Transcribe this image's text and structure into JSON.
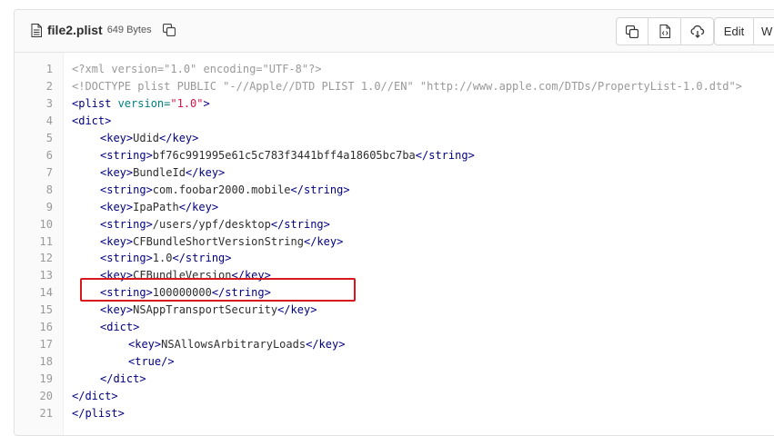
{
  "header": {
    "file_name": "file2.plist",
    "file_size": "649 Bytes",
    "edit_label": "Edit",
    "web_ide_label": "W"
  },
  "icons": {
    "file": "file-icon",
    "copy_path": "copy-icon",
    "copy_contents": "copy-icon",
    "open_raw": "file-code-icon",
    "download": "cloud-download-icon"
  },
  "colors": {
    "tag": "#000080",
    "attribute": "#008080",
    "string": "#dd1144",
    "meta": "#999999",
    "highlight_border": "#d9181e"
  },
  "code_lines": [
    {
      "n": "1",
      "indent": 0,
      "tokens": [
        {
          "t": "meta",
          "v": "<?xml version=\"1.0\" encoding=\"UTF-8\"?>"
        }
      ]
    },
    {
      "n": "2",
      "indent": 0,
      "tokens": [
        {
          "t": "meta",
          "v": "<!DOCTYPE plist PUBLIC \"-//Apple//DTD PLIST 1.0//EN\" \"http://www.apple.com/DTDs/PropertyList-1.0.dtd\">"
        }
      ]
    },
    {
      "n": "3",
      "indent": 0,
      "tokens": [
        {
          "t": "tag",
          "v": "<plist "
        },
        {
          "t": "attr",
          "v": "version="
        },
        {
          "t": "str",
          "v": "\"1.0\""
        },
        {
          "t": "tag",
          "v": ">"
        }
      ]
    },
    {
      "n": "4",
      "indent": 0,
      "tokens": [
        {
          "t": "tag",
          "v": "<dict>"
        }
      ]
    },
    {
      "n": "5",
      "indent": 1,
      "tokens": [
        {
          "t": "tag",
          "v": "<key>"
        },
        {
          "t": "text",
          "v": "Udid"
        },
        {
          "t": "tag",
          "v": "</key>"
        }
      ]
    },
    {
      "n": "6",
      "indent": 1,
      "tokens": [
        {
          "t": "tag",
          "v": "<string>"
        },
        {
          "t": "text",
          "v": "bf76c991995e61c5c783f3441bff4a18605bc7ba"
        },
        {
          "t": "tag",
          "v": "</string>"
        }
      ]
    },
    {
      "n": "7",
      "indent": 1,
      "tokens": [
        {
          "t": "tag",
          "v": "<key>"
        },
        {
          "t": "text",
          "v": "BundleId"
        },
        {
          "t": "tag",
          "v": "</key>"
        }
      ]
    },
    {
      "n": "8",
      "indent": 1,
      "tokens": [
        {
          "t": "tag",
          "v": "<string>"
        },
        {
          "t": "text",
          "v": "com.foobar2000.mobile"
        },
        {
          "t": "tag",
          "v": "</string>"
        }
      ]
    },
    {
      "n": "9",
      "indent": 1,
      "tokens": [
        {
          "t": "tag",
          "v": "<key>"
        },
        {
          "t": "text",
          "v": "IpaPath"
        },
        {
          "t": "tag",
          "v": "</key>"
        }
      ]
    },
    {
      "n": "10",
      "indent": 1,
      "tokens": [
        {
          "t": "tag",
          "v": "<string>"
        },
        {
          "t": "text",
          "v": "/users/ypf/desktop"
        },
        {
          "t": "tag",
          "v": "</string>"
        }
      ]
    },
    {
      "n": "11",
      "indent": 1,
      "tokens": [
        {
          "t": "tag",
          "v": "<key>"
        },
        {
          "t": "text",
          "v": "CFBundleShortVersionString"
        },
        {
          "t": "tag",
          "v": "</key>"
        }
      ]
    },
    {
      "n": "12",
      "indent": 1,
      "tokens": [
        {
          "t": "tag",
          "v": "<string>"
        },
        {
          "t": "text",
          "v": "1.0"
        },
        {
          "t": "tag",
          "v": "</string>"
        }
      ]
    },
    {
      "n": "13",
      "indent": 1,
      "tokens": [
        {
          "t": "tag",
          "v": "<key>"
        },
        {
          "t": "text",
          "v": "CFBundleVersion"
        },
        {
          "t": "tag",
          "v": "</key>"
        }
      ]
    },
    {
      "n": "14",
      "indent": 1,
      "tokens": [
        {
          "t": "tag",
          "v": "<string>"
        },
        {
          "t": "text",
          "v": "100000000"
        },
        {
          "t": "tag",
          "v": "</string>"
        }
      ]
    },
    {
      "n": "15",
      "indent": 1,
      "tokens": [
        {
          "t": "tag",
          "v": "<key>"
        },
        {
          "t": "text",
          "v": "NSAppTransportSecurity"
        },
        {
          "t": "tag",
          "v": "</key>"
        }
      ]
    },
    {
      "n": "16",
      "indent": 1,
      "tokens": [
        {
          "t": "tag",
          "v": "<dict>"
        }
      ]
    },
    {
      "n": "17",
      "indent": 2,
      "tokens": [
        {
          "t": "tag",
          "v": "<key>"
        },
        {
          "t": "text",
          "v": "NSAllowsArbitraryLoads"
        },
        {
          "t": "tag",
          "v": "</key>"
        }
      ]
    },
    {
      "n": "18",
      "indent": 2,
      "tokens": [
        {
          "t": "tag",
          "v": "<true/>"
        }
      ]
    },
    {
      "n": "19",
      "indent": 1,
      "tokens": [
        {
          "t": "tag",
          "v": "</dict>"
        }
      ]
    },
    {
      "n": "20",
      "indent": 0,
      "tokens": [
        {
          "t": "tag",
          "v": "</dict>"
        }
      ]
    },
    {
      "n": "21",
      "indent": 0,
      "tokens": [
        {
          "t": "tag",
          "v": "</plist>"
        }
      ]
    }
  ]
}
